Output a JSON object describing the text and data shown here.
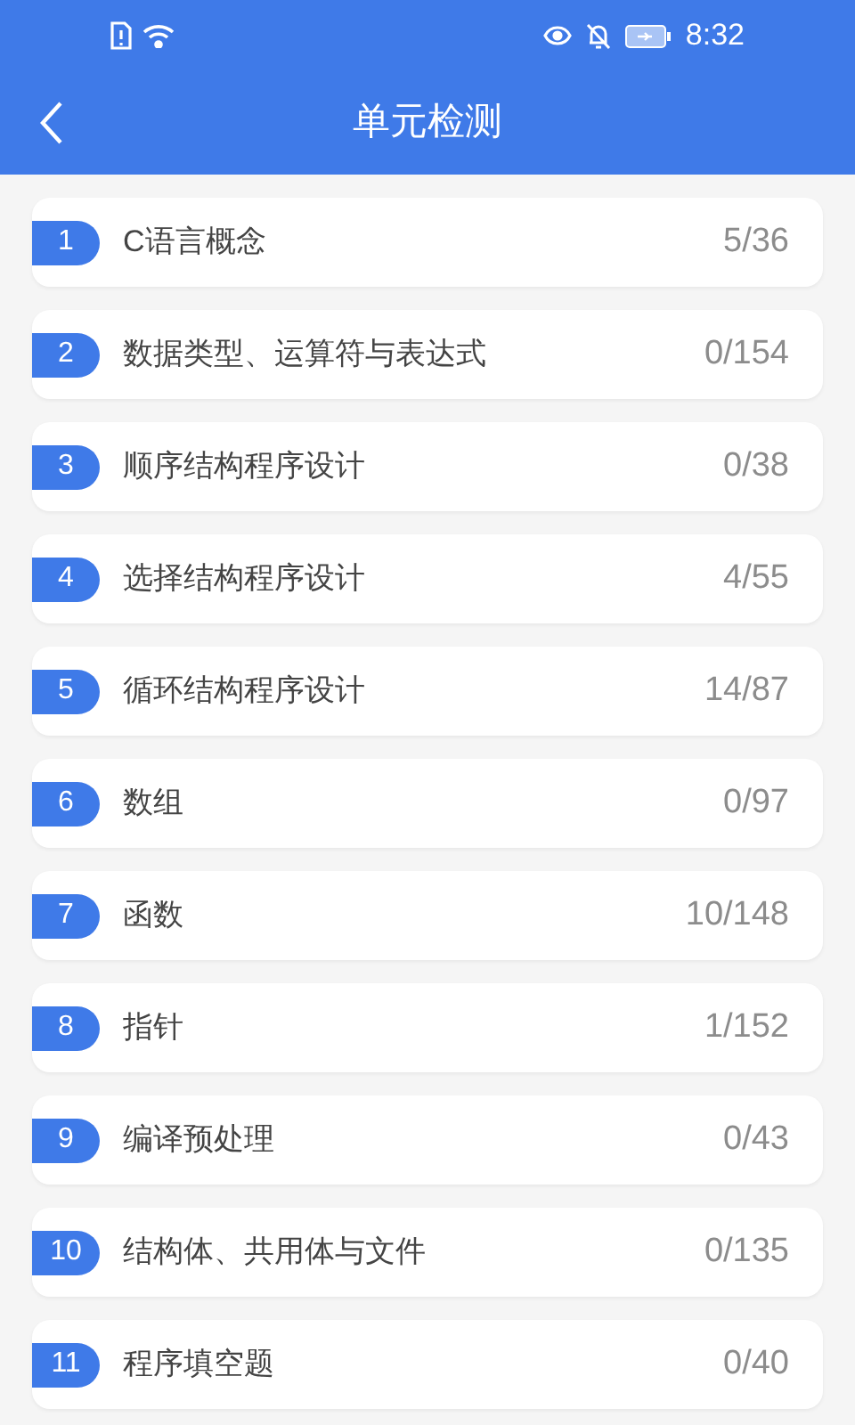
{
  "status_bar": {
    "time": "8:32"
  },
  "header": {
    "title": "单元检测"
  },
  "units": [
    {
      "number": "1",
      "title": "C语言概念",
      "progress": "5/36"
    },
    {
      "number": "2",
      "title": "数据类型、运算符与表达式",
      "progress": "0/154"
    },
    {
      "number": "3",
      "title": "顺序结构程序设计",
      "progress": "0/38"
    },
    {
      "number": "4",
      "title": "选择结构程序设计",
      "progress": "4/55"
    },
    {
      "number": "5",
      "title": "循环结构程序设计",
      "progress": "14/87"
    },
    {
      "number": "6",
      "title": "数组",
      "progress": "0/97"
    },
    {
      "number": "7",
      "title": "函数",
      "progress": "10/148"
    },
    {
      "number": "8",
      "title": "指针",
      "progress": "1/152"
    },
    {
      "number": "9",
      "title": "编译预处理",
      "progress": "0/43"
    },
    {
      "number": "10",
      "title": "结构体、共用体与文件",
      "progress": "0/135"
    },
    {
      "number": "11",
      "title": "程序填空题",
      "progress": "0/40"
    }
  ]
}
